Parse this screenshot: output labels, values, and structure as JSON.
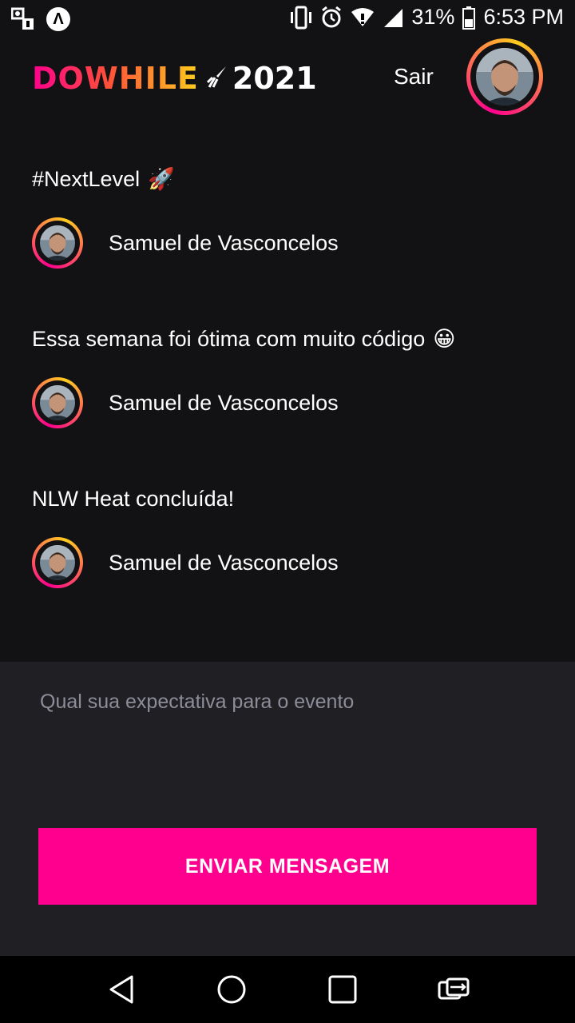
{
  "status_bar": {
    "battery": "31%",
    "time": "6:53 PM",
    "launcher_icon_letter": "Λ",
    "icons": [
      "vpn-key-icon",
      "launcher-icon",
      "vibrate-icon",
      "alarm-icon",
      "wifi-icon",
      "signal-icon",
      "battery-icon"
    ]
  },
  "header": {
    "logo_text": "DOWHILE",
    "logo_year": "2021",
    "signout_label": "Sair"
  },
  "messages": [
    {
      "text": "#NextLevel",
      "emoji": "🚀",
      "author": "Samuel de Vasconcelos"
    },
    {
      "text": "Essa semana foi ótima com muito código",
      "emoji": "😀",
      "author": "Samuel de Vasconcelos"
    },
    {
      "text": "NLW Heat concluída!",
      "emoji": "",
      "author": "Samuel de Vasconcelos"
    }
  ],
  "composer": {
    "placeholder": "Qual sua expectativa para o evento",
    "value": "",
    "send_label": "ENVIAR MENSAGEM"
  },
  "colors": {
    "background": "#121214",
    "composer_bg": "#202024",
    "accent": "#ff008e",
    "gradient_end": "#ffcd1e"
  },
  "nav": [
    "back-icon",
    "home-icon",
    "recents-icon",
    "switch-app-icon"
  ]
}
